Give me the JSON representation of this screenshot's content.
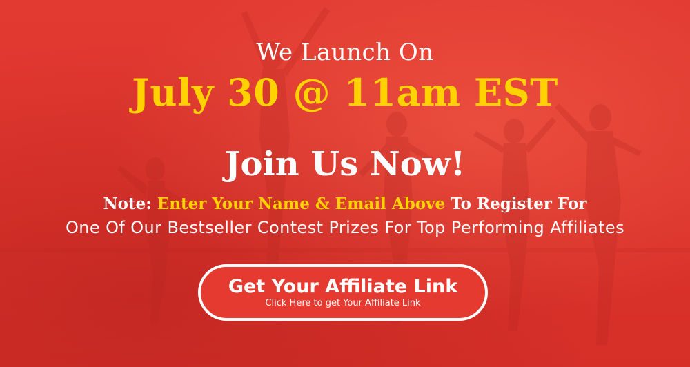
{
  "banner": {
    "launch_text": "We Launch On",
    "launch_date": "July 30 @ 11am EST",
    "join_heading": "Join Us Now!",
    "note": {
      "prefix": "Note: ",
      "highlight": "Enter Your Name & Email Above",
      "suffix": " To Register For"
    },
    "prize_text": "One Of Our Bestseller Contest Prizes For Top Performing Affiliates",
    "cta": {
      "title": "Get Your Affiliate Link",
      "subtitle": "Click Here to get Your Affiliate Link"
    }
  },
  "colors": {
    "background": "#e2342c",
    "accent_yellow": "#ffd200",
    "text_white": "#ffffff"
  }
}
